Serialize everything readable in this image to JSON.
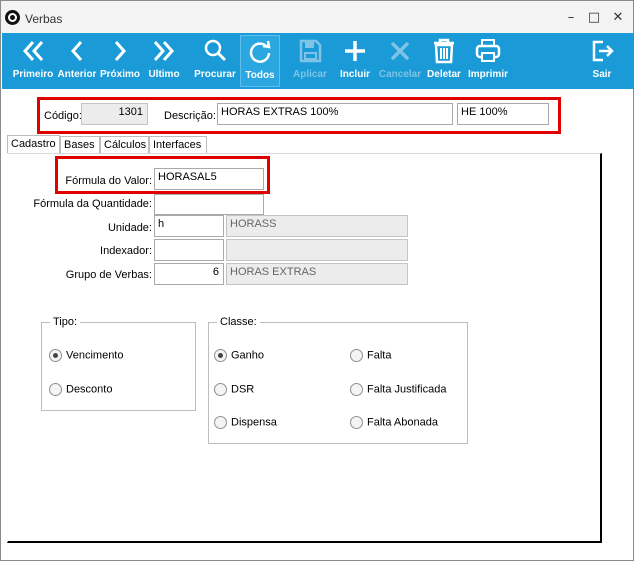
{
  "window": {
    "title": "Verbas",
    "minimize": "–",
    "maximize": "□",
    "close": "✕"
  },
  "toolbar": [
    {
      "name": "primeiro-button",
      "icon": "double-chevron-left-icon",
      "label": "Primeiro",
      "enabled": true
    },
    {
      "name": "anterior-button",
      "icon": "chevron-left-icon",
      "label": "Anterior",
      "enabled": true
    },
    {
      "name": "proximo-button",
      "icon": "chevron-right-icon",
      "label": "Próximo",
      "enabled": true
    },
    {
      "name": "ultimo-button",
      "icon": "double-chevron-right-icon",
      "label": "Ultimo",
      "enabled": true
    },
    {
      "name": "procurar-button",
      "icon": "search-icon",
      "label": "Procurar",
      "enabled": true
    },
    {
      "name": "todos-button",
      "icon": "refresh-icon",
      "label": "Todos",
      "enabled": true,
      "active": true
    },
    {
      "name": "aplicar-button",
      "icon": "save-icon",
      "label": "Aplicar",
      "enabled": false
    },
    {
      "name": "incluir-button",
      "icon": "plus-icon",
      "label": "Incluir",
      "enabled": true
    },
    {
      "name": "cancelar-button",
      "icon": "x-icon",
      "label": "Cancelar",
      "enabled": false
    },
    {
      "name": "deletar-button",
      "icon": "trash-icon",
      "label": "Deletar",
      "enabled": true
    },
    {
      "name": "imprimir-button",
      "icon": "printer-icon",
      "label": "Imprimir",
      "enabled": true
    },
    {
      "name": "sair-button",
      "icon": "exit-icon",
      "label": "Sair",
      "enabled": true
    }
  ],
  "header": {
    "codigo_label": "Código:",
    "codigo_value": "1301",
    "descricao_label": "Descrição:",
    "descricao_value": "HORAS EXTRAS 100%",
    "abreviacao_value": "HE 100%"
  },
  "tabs": [
    "Cadastro",
    "Bases",
    "Cálculos",
    "Interfaces"
  ],
  "active_tab": "Cadastro",
  "form": {
    "formula_valor_label": "Fórmula do Valor:",
    "formula_valor_value": "HORASAL5",
    "formula_quantidade_label": "Fórmula da Quantidade:",
    "formula_quantidade_value": "",
    "unidade_label": "Unidade:",
    "unidade_value": "h",
    "unidade_desc": "HORASS",
    "indexador_label": "Indexador:",
    "indexador_value": "",
    "indexador_desc": "",
    "grupo_label": "Grupo de Verbas:",
    "grupo_value": "6",
    "grupo_desc": "HORAS EXTRAS"
  },
  "tipo": {
    "title": "Tipo:",
    "options": [
      {
        "label": "Vencimento",
        "checked": true
      },
      {
        "label": "Desconto",
        "checked": false
      }
    ]
  },
  "classe": {
    "title": "Classe:",
    "options": [
      {
        "label": "Ganho",
        "checked": true
      },
      {
        "label": "DSR",
        "checked": false
      },
      {
        "label": "Dispensa",
        "checked": false
      },
      {
        "label": "Falta",
        "checked": false
      },
      {
        "label": "Falta Justificada",
        "checked": false
      },
      {
        "label": "Falta Abonada",
        "checked": false
      }
    ]
  },
  "colors": {
    "toolbar_bg": "#1a9bd7",
    "highlight": "#e00000"
  }
}
